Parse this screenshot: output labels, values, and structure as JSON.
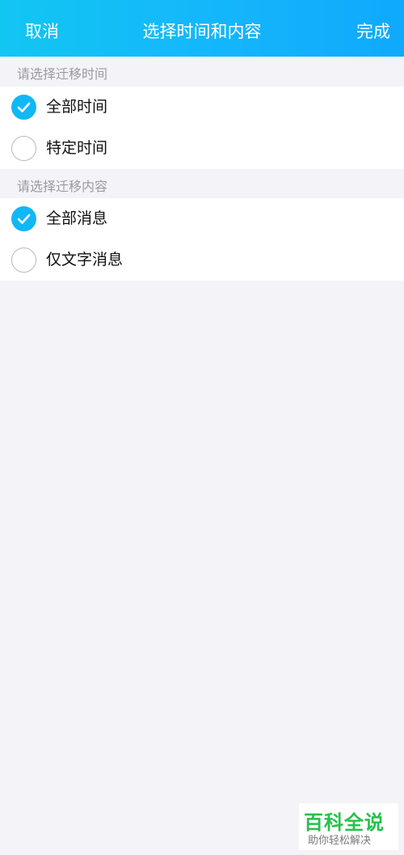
{
  "header": {
    "cancel_label": "取消",
    "title": "选择时间和内容",
    "done_label": "完成"
  },
  "time_section": {
    "label": "请选择迁移时间",
    "options": [
      {
        "label": "全部时间",
        "selected": true
      },
      {
        "label": "特定时间",
        "selected": false
      }
    ]
  },
  "content_section": {
    "label": "请选择迁移内容",
    "options": [
      {
        "label": "全部消息",
        "selected": true
      },
      {
        "label": "仅文字消息",
        "selected": false
      }
    ]
  },
  "watermark": {
    "main": "百科全说",
    "sub": "助你轻松解决"
  },
  "colors": {
    "header_start": "#12c6f3",
    "header_end": "#10a9fc",
    "accent": "#12b7f5",
    "background": "#f3f3f8",
    "watermark_green": "#27c04a"
  },
  "icons": {
    "checked": "check-circle-icon",
    "unchecked": "empty-circle-icon"
  }
}
